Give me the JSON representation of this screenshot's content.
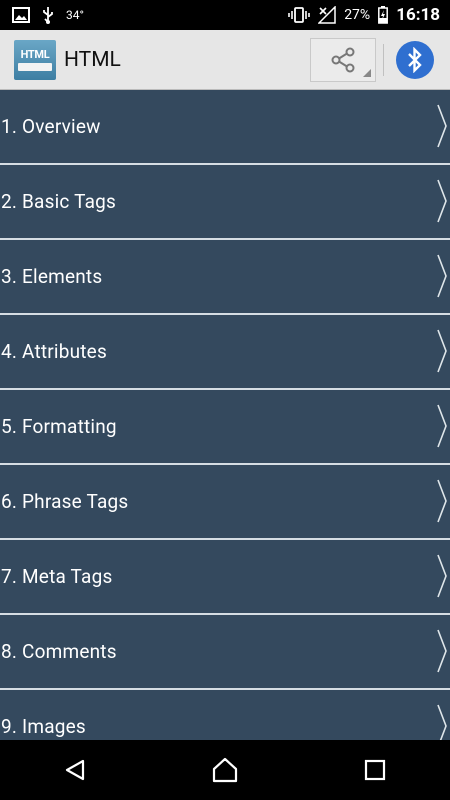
{
  "status_bar": {
    "temperature": "34°",
    "battery_percent": "27%",
    "time": "16:18"
  },
  "app_bar": {
    "title": "HTML",
    "logo_text": "HTML"
  },
  "menu": {
    "items": [
      {
        "label": "1. Overview"
      },
      {
        "label": "2. Basic Tags"
      },
      {
        "label": "3. Elements"
      },
      {
        "label": "4. Attributes"
      },
      {
        "label": "5. Formatting"
      },
      {
        "label": "6. Phrase Tags"
      },
      {
        "label": "7. Meta Tags"
      },
      {
        "label": "8. Comments"
      },
      {
        "label": "9. Images"
      }
    ]
  },
  "colors": {
    "list_background": "#34495e",
    "separator": "#d6dde3",
    "bluetooth_accent": "#2f6fd0",
    "app_bar_bg": "#e6e6e6"
  },
  "icons": [
    "image-icon",
    "usb-icon",
    "vibrate-icon",
    "no-signal-icon",
    "battery-icon",
    "share-icon",
    "bluetooth-icon",
    "chevron-right-icon",
    "back-icon",
    "home-icon",
    "recents-icon"
  ]
}
